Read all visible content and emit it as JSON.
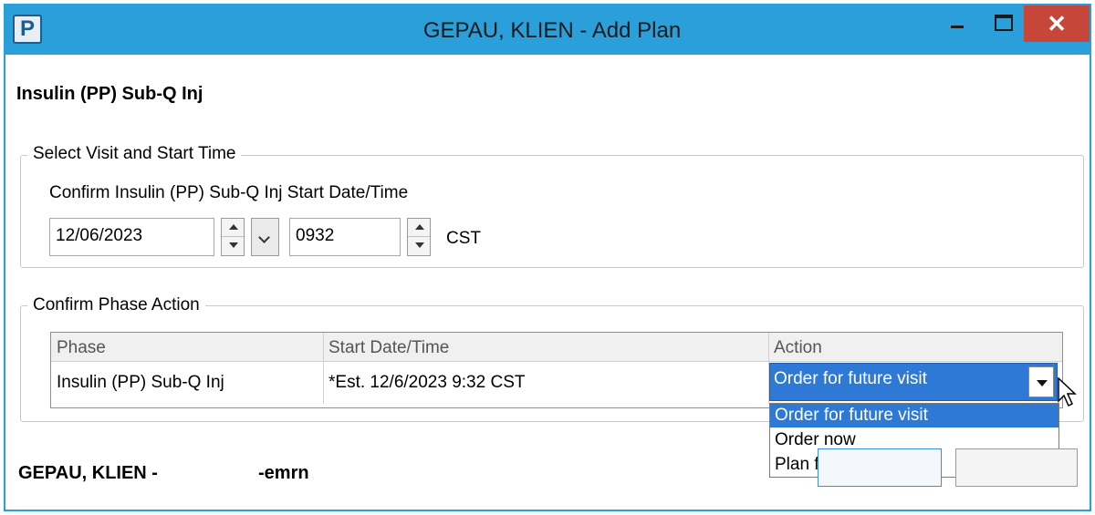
{
  "window": {
    "app_icon_letter": "P",
    "title": "GEPAU, KLIEN - Add Plan",
    "accent_color": "#2b9fd9",
    "close_color": "#c7463a"
  },
  "plan_name": "Insulin (PP) Sub-Q Inj",
  "visit_group": {
    "legend": "Select Visit and Start Time",
    "confirm_label": "Confirm Insulin (PP) Sub-Q Inj Start Date/Time",
    "date_value": "12/06/2023",
    "time_value": "0932",
    "timezone": "CST"
  },
  "phase_group": {
    "legend": "Confirm Phase Action",
    "columns": [
      "Phase",
      "Start Date/Time",
      "Action"
    ],
    "row": {
      "phase": "Insulin (PP) Sub-Q Inj",
      "start": "*Est. 12/6/2023 9:32 CST",
      "action": "Order for future visit"
    },
    "action_options": [
      "Order for future visit",
      "Order now",
      "Plan for a later date"
    ],
    "selected_color": "#2f79d6"
  },
  "footer": {
    "patient": "GEPAU, KLIEN -",
    "mrn": "-emrn"
  }
}
